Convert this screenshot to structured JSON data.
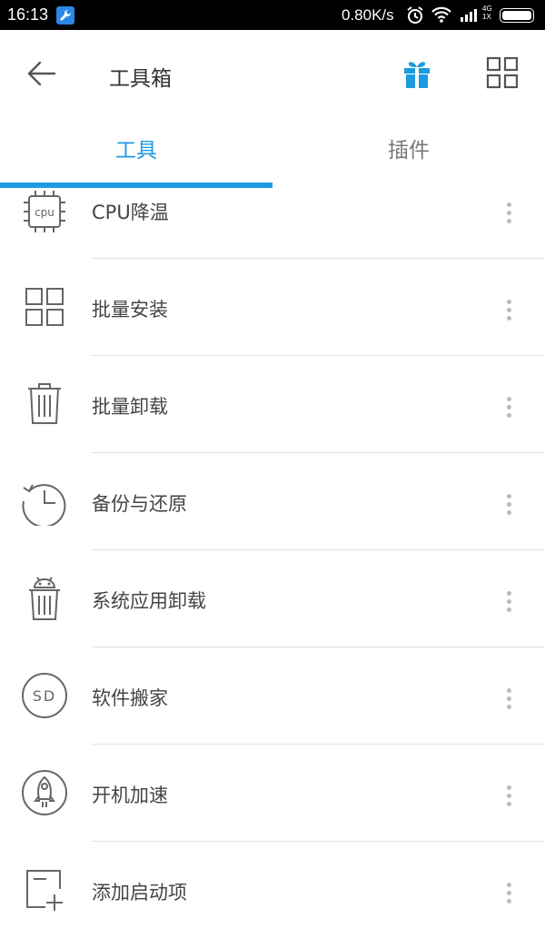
{
  "status_bar": {
    "time": "16:13",
    "net_speed": "0.80K/s",
    "network_type_top": "4G",
    "network_type_bottom": "1X"
  },
  "header": {
    "title": "工具箱",
    "back_icon": "arrow-left-icon",
    "gift_icon": "gift-icon",
    "grid_icon": "grid-icon"
  },
  "tabs": [
    {
      "label": "工具",
      "active": true
    },
    {
      "label": "插件",
      "active": false
    }
  ],
  "accent_color": "#1e9be0",
  "tools": [
    {
      "label": "CPU降温",
      "icon": "cpu-chip-icon",
      "icon_text": "cpu"
    },
    {
      "label": "批量安装",
      "icon": "four-squares-icon"
    },
    {
      "label": "批量卸载",
      "icon": "trash-can-icon"
    },
    {
      "label": "备份与还原",
      "icon": "clock-restore-icon"
    },
    {
      "label": "系统应用卸载",
      "icon": "android-trash-icon"
    },
    {
      "label": "软件搬家",
      "icon": "sd-card-icon",
      "icon_text": "SD"
    },
    {
      "label": "开机加速",
      "icon": "rocket-icon"
    },
    {
      "label": "添加启动项",
      "icon": "add-startup-icon"
    }
  ]
}
